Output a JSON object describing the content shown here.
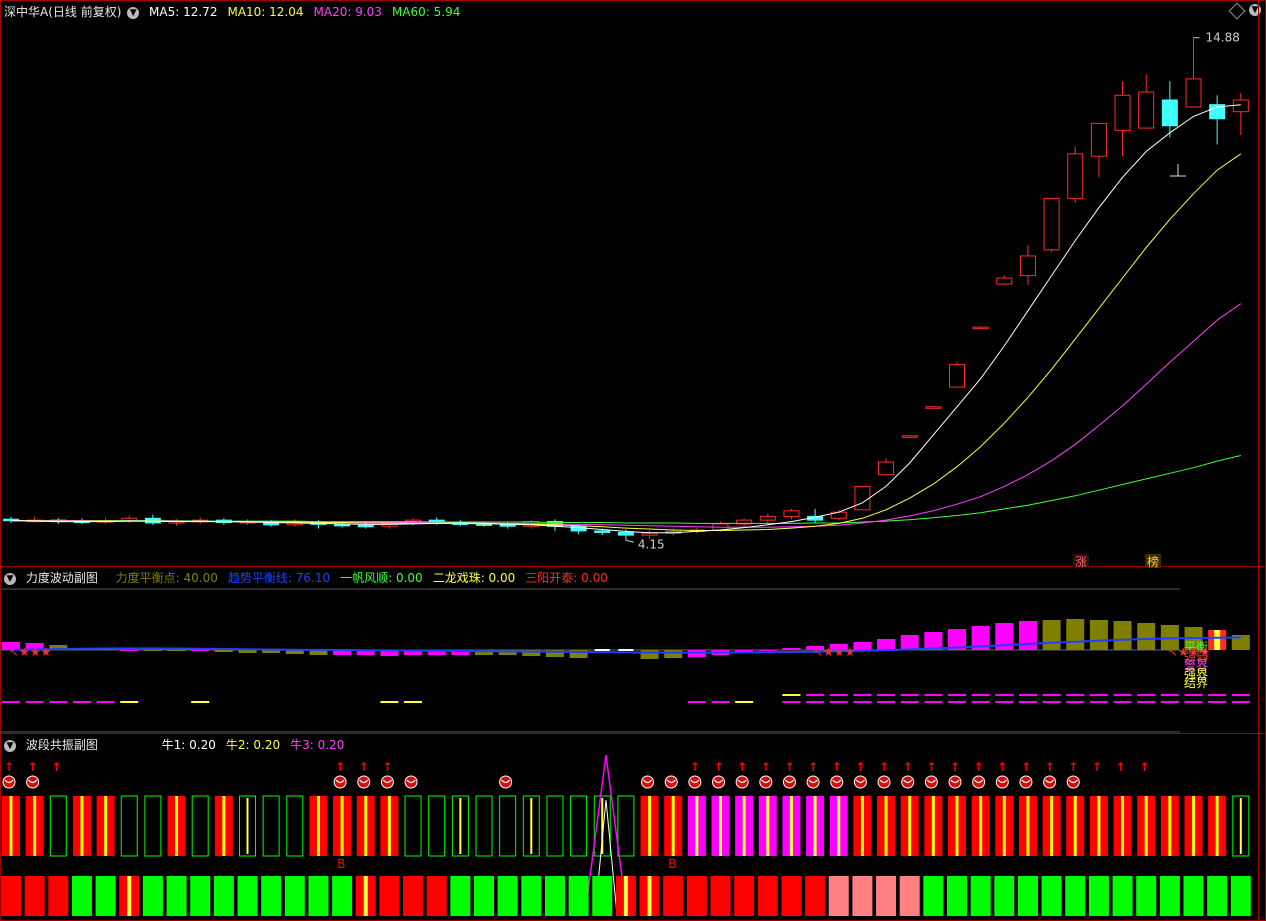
{
  "colors": {
    "up": "#ff2a2a",
    "down": "#40ffff",
    "ma5": "#ffffff",
    "ma10": "#ffff40",
    "ma20": "#ff40ff",
    "ma60": "#40ff40",
    "olive": "#808000",
    "magenta": "#ff00ff",
    "blue": "#2040ff",
    "green": "#00ff00",
    "red": "#ff0000",
    "pink": "#ff8080"
  },
  "main": {
    "title": "深中华A(日线 前复权)",
    "legend": [
      {
        "label": "MA5: 12.72",
        "color": "#ffffff"
      },
      {
        "label": "MA10: 12.04",
        "color": "#ffff40"
      },
      {
        "label": "MA20: 9.03",
        "color": "#ff40ff"
      },
      {
        "label": "MA60: 5.94",
        "color": "#40ff40"
      }
    ],
    "high_label": "14.88",
    "low_label": "4.15",
    "badge_limit": "涨",
    "badge_list": "榜"
  },
  "chart_data": [
    {
      "type": "candlestick",
      "title": "深中华A(日线 前复权)",
      "ylim": [
        3.9,
        15.3
      ],
      "high": 14.88,
      "low": 4.15,
      "candles_ohlc": [
        [
          4.6,
          4.58,
          4.65,
          4.52
        ],
        [
          4.58,
          4.58,
          4.65,
          4.54
        ],
        [
          4.58,
          4.55,
          4.62,
          4.5
        ],
        [
          4.56,
          4.55,
          4.62,
          4.5
        ],
        [
          4.55,
          4.57,
          4.63,
          4.5
        ],
        [
          4.57,
          4.62,
          4.68,
          4.52
        ],
        [
          4.62,
          4.52,
          4.7,
          4.48
        ],
        [
          4.52,
          4.55,
          4.6,
          4.46
        ],
        [
          4.55,
          4.58,
          4.64,
          4.5
        ],
        [
          4.58,
          4.53,
          4.62,
          4.48
        ],
        [
          4.53,
          4.55,
          4.6,
          4.48
        ],
        [
          4.55,
          4.48,
          4.58,
          4.44
        ],
        [
          4.48,
          4.55,
          4.6,
          4.44
        ],
        [
          4.55,
          4.49,
          4.58,
          4.4
        ],
        [
          4.49,
          4.47,
          4.55,
          4.42
        ],
        [
          4.47,
          4.45,
          4.52,
          4.4
        ],
        [
          4.45,
          4.51,
          4.55,
          4.4
        ],
        [
          4.51,
          4.58,
          4.62,
          4.46
        ],
        [
          4.58,
          4.52,
          4.64,
          4.48
        ],
        [
          4.52,
          4.5,
          4.58,
          4.45
        ],
        [
          4.5,
          4.49,
          4.55,
          4.44
        ],
        [
          4.49,
          4.45,
          4.53,
          4.4
        ],
        [
          4.45,
          4.55,
          4.58,
          4.4
        ],
        [
          4.55,
          4.45,
          4.6,
          4.35
        ],
        [
          4.45,
          4.35,
          4.48,
          4.28
        ],
        [
          4.35,
          4.32,
          4.4,
          4.26
        ],
        [
          4.32,
          4.26,
          4.38,
          4.15
        ],
        [
          4.26,
          4.3,
          4.36,
          4.18
        ],
        [
          4.3,
          4.34,
          4.4,
          4.25
        ],
        [
          4.34,
          4.37,
          4.42,
          4.3
        ],
        [
          4.37,
          4.5,
          4.55,
          4.34
        ],
        [
          4.5,
          4.58,
          4.62,
          4.44
        ],
        [
          4.58,
          4.66,
          4.72,
          4.52
        ],
        [
          4.66,
          4.78,
          4.82,
          4.6
        ],
        [
          4.66,
          4.58,
          4.82,
          4.52
        ],
        [
          4.62,
          4.75,
          4.8,
          4.58
        ],
        [
          4.8,
          5.3,
          5.3,
          4.8
        ],
        [
          5.55,
          5.82,
          5.9,
          5.55
        ],
        [
          6.38,
          6.38,
          6.4,
          6.36
        ],
        [
          7.0,
          7.0,
          7.02,
          6.98
        ],
        [
          7.42,
          7.9,
          7.95,
          7.42
        ],
        [
          8.7,
          8.7,
          8.72,
          8.68
        ],
        [
          9.62,
          9.75,
          9.8,
          9.6
        ],
        [
          9.8,
          10.22,
          10.45,
          9.6
        ],
        [
          10.35,
          11.45,
          11.45,
          10.3
        ],
        [
          11.45,
          12.4,
          12.55,
          11.35
        ],
        [
          12.35,
          13.05,
          13.05,
          11.9
        ],
        [
          12.9,
          13.65,
          13.95,
          12.35
        ],
        [
          12.95,
          13.72,
          14.1,
          12.95
        ],
        [
          13.55,
          13.0,
          13.95,
          12.75
        ],
        [
          13.4,
          14.0,
          14.88,
          13.4
        ],
        [
          13.45,
          13.15,
          13.65,
          12.6
        ],
        [
          13.3,
          13.55,
          13.7,
          12.8
        ]
      ],
      "ma5": [
        4.57,
        4.56,
        4.55,
        4.55,
        4.55,
        4.56,
        4.56,
        4.55,
        4.56,
        4.55,
        4.54,
        4.53,
        4.52,
        4.51,
        4.5,
        4.49,
        4.49,
        4.5,
        4.51,
        4.52,
        4.51,
        4.49,
        4.48,
        4.45,
        4.42,
        4.38,
        4.34,
        4.31,
        4.31,
        4.34,
        4.37,
        4.42,
        4.48,
        4.55,
        4.64,
        4.75,
        4.95,
        5.3,
        5.8,
        6.4,
        7.0,
        7.6,
        8.3,
        9.05,
        9.8,
        10.55,
        11.25,
        11.9,
        12.45,
        12.85,
        13.2,
        13.4,
        13.45
      ],
      "ma10": [
        4.57,
        4.57,
        4.56,
        4.56,
        4.56,
        4.56,
        4.56,
        4.55,
        4.55,
        4.55,
        4.55,
        4.54,
        4.54,
        4.53,
        4.53,
        4.52,
        4.52,
        4.51,
        4.51,
        4.51,
        4.5,
        4.5,
        4.49,
        4.48,
        4.46,
        4.44,
        4.41,
        4.39,
        4.37,
        4.36,
        4.36,
        4.37,
        4.38,
        4.41,
        4.45,
        4.51,
        4.62,
        4.8,
        5.05,
        5.35,
        5.72,
        6.15,
        6.65,
        7.2,
        7.8,
        8.45,
        9.1,
        9.75,
        10.4,
        11.0,
        11.55,
        12.05,
        12.4
      ],
      "ma20": [
        4.57,
        4.57,
        4.57,
        4.57,
        4.56,
        4.56,
        4.56,
        4.56,
        4.55,
        4.55,
        4.55,
        4.55,
        4.54,
        4.54,
        4.54,
        4.53,
        4.53,
        4.53,
        4.52,
        4.52,
        4.52,
        4.51,
        4.51,
        4.5,
        4.49,
        4.48,
        4.47,
        4.46,
        4.45,
        4.44,
        4.43,
        4.43,
        4.43,
        4.44,
        4.45,
        4.47,
        4.52,
        4.58,
        4.67,
        4.78,
        4.92,
        5.08,
        5.3,
        5.55,
        5.85,
        6.2,
        6.6,
        7.02,
        7.48,
        7.95,
        8.4,
        8.85,
        9.2
      ],
      "ma60": [
        4.57,
        4.57,
        4.57,
        4.57,
        4.57,
        4.57,
        4.57,
        4.57,
        4.56,
        4.56,
        4.56,
        4.56,
        4.56,
        4.55,
        4.55,
        4.55,
        4.55,
        4.55,
        4.54,
        4.54,
        4.54,
        4.54,
        4.54,
        4.53,
        4.53,
        4.53,
        4.52,
        4.52,
        4.52,
        4.51,
        4.51,
        4.51,
        4.51,
        4.51,
        4.52,
        4.52,
        4.54,
        4.56,
        4.59,
        4.63,
        4.68,
        4.74,
        4.82,
        4.9,
        5.0,
        5.1,
        5.22,
        5.34,
        5.46,
        5.58,
        5.7,
        5.84,
        5.96
      ]
    },
    {
      "type": "bar",
      "title": "力度波动副图",
      "legend": [
        {
          "label": "力度平衡点: 40.00",
          "color": "#808000"
        },
        {
          "label": "趋势平衡线: 76.10",
          "color": "#2040ff"
        },
        {
          "label": "一帆风顺: 0.00",
          "color": "#40ff40"
        },
        {
          "label": "二龙戏珠: 0.00",
          "color": "#ffff40"
        },
        {
          "label": "三阳开泰: 0.00",
          "color": "#ff2a2a"
        }
      ],
      "ylim": [
        -40,
        100
      ],
      "balance_level": 40,
      "bar_values": [
        48,
        47,
        45,
        42,
        42,
        40,
        40,
        40,
        39,
        38,
        37,
        37,
        36,
        35,
        35,
        35,
        34,
        35,
        35,
        35,
        35,
        35,
        34,
        33,
        32,
        32,
        31,
        31,
        32,
        33,
        35,
        37,
        40,
        42,
        44,
        46,
        48,
        51,
        55,
        58,
        61,
        64,
        67,
        69,
        70,
        71,
        70,
        69,
        67,
        65,
        63,
        60,
        55
      ],
      "bar_colors": [
        "m",
        "m",
        "o",
        "o",
        "o",
        "m",
        "o",
        "o",
        "m",
        "o",
        "o",
        "o",
        "o",
        "o",
        "m",
        "m",
        "m",
        "m",
        "m",
        "m",
        "o",
        "o",
        "o",
        "o",
        "o",
        "w",
        "w",
        "o",
        "o",
        "m",
        "m",
        "m",
        "m",
        "m",
        "m",
        "m",
        "m",
        "m",
        "m",
        "m",
        "m",
        "m",
        "m",
        "m",
        "o",
        "o",
        "o",
        "o",
        "o",
        "o",
        "o",
        "y",
        "o"
      ],
      "trend_line": [
        40.0,
        40.5,
        41.0,
        41.3,
        41.5,
        41.6,
        41.6,
        41.5,
        41.3,
        41.0,
        40.7,
        40.5,
        40.3,
        40.1,
        40.0,
        39.8,
        39.6,
        39.4,
        39.2,
        39.0,
        38.8,
        38.6,
        38.4,
        38.2,
        38.0,
        37.8,
        37.6,
        37.5,
        37.4,
        37.4,
        37.5,
        37.6,
        37.8,
        38.0,
        38.3,
        38.7,
        39.2,
        39.8,
        40.6,
        41.5,
        42.5,
        43.6,
        44.8,
        46.0,
        47.2,
        48.3,
        49.3,
        50.2,
        51.0,
        51.6,
        52.0,
        52.3,
        52.5
      ],
      "marker_rows": [
        {
          "color": "#ff00ff",
          "value": -12,
          "days": [
            0,
            1,
            2,
            3,
            4,
            29,
            30,
            33,
            34,
            35,
            36,
            37,
            38,
            39,
            40,
            41,
            42,
            43,
            44,
            45,
            46,
            47,
            48,
            49,
            50,
            51,
            52
          ]
        },
        {
          "color": "#ffff40",
          "value": -12,
          "days": [
            5,
            8,
            16,
            17,
            31
          ]
        },
        {
          "color": "#ffff40",
          "value": -5,
          "days": [
            33
          ]
        },
        {
          "color": "#ff00ff",
          "value": -5,
          "days": [
            34,
            35,
            36,
            37,
            38,
            39,
            40,
            41,
            42,
            43,
            44,
            45,
            46,
            47,
            48,
            49,
            50,
            51,
            52
          ]
        }
      ],
      "star_labels": [
        "↖★★★",
        "↖★★★",
        "↖★★★"
      ],
      "right_labels": [
        "平衡",
        "强弱",
        "警界",
        "强界",
        "结界"
      ]
    },
    {
      "type": "bar",
      "title": "波段共振副图",
      "legend": [
        {
          "label": "牛1: 0.20",
          "color": "#ffffff"
        },
        {
          "label": "牛2: 0.20",
          "color": "#ffff40"
        },
        {
          "label": "牛3: 0.20",
          "color": "#ff40ff"
        }
      ],
      "resonance_bars": [
        "r",
        "r",
        "g",
        "r",
        "r",
        "g",
        "g",
        "r",
        "g",
        "r",
        "g",
        "g",
        "g",
        "r",
        "r",
        "r",
        "r",
        "g",
        "g",
        "g",
        "g",
        "g",
        "g",
        "g",
        "g",
        "g",
        "g",
        "r",
        "r",
        "m",
        "m",
        "m",
        "m",
        "m",
        "m",
        "m",
        "r",
        "r",
        "r",
        "r",
        "r",
        "r",
        "r",
        "r",
        "r",
        "r",
        "r",
        "r",
        "r",
        "r",
        "r",
        "r",
        "g"
      ],
      "bottom_bars": [
        "r",
        "r",
        "r",
        "g",
        "g",
        "y",
        "g",
        "g",
        "g",
        "g",
        "g",
        "g",
        "g",
        "g",
        "g",
        "y",
        "r",
        "r",
        "r",
        "g",
        "g",
        "g",
        "g",
        "g",
        "g",
        "g",
        "y",
        "y",
        "r",
        "r",
        "r",
        "r",
        "r",
        "r",
        "r",
        "p",
        "p",
        "p",
        "p",
        "g",
        "g",
        "g",
        "g",
        "g",
        "g",
        "g",
        "g",
        "g",
        "g",
        "g",
        "g",
        "g",
        "g"
      ],
      "arrow_days": [
        0,
        1,
        2,
        14,
        15,
        16,
        29,
        30,
        31,
        32,
        33,
        34,
        35,
        36,
        37,
        38,
        39,
        40,
        41,
        42,
        43,
        44,
        45,
        46,
        47,
        48
      ],
      "ball_days": [
        0,
        1,
        14,
        15,
        16,
        17,
        21,
        27,
        28,
        29,
        30,
        31,
        32,
        33,
        34,
        35,
        36,
        37,
        38,
        39,
        40,
        41,
        42,
        43,
        44,
        45
      ],
      "buy_labels": [
        {
          "day": 14,
          "text": "B"
        },
        {
          "day": 28,
          "text": "B"
        }
      ]
    }
  ],
  "panel2": {
    "title": "力度波动副图"
  },
  "panel3": {
    "title": "波段共振副图"
  }
}
